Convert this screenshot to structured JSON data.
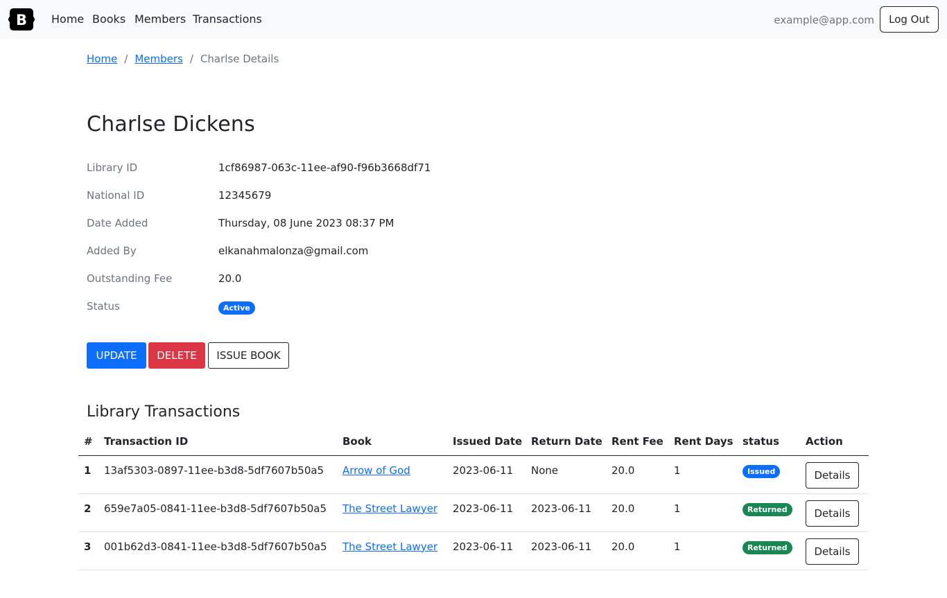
{
  "nav": {
    "brand_letter": "B",
    "links": [
      "Home",
      "Books",
      "Members",
      "Transactions"
    ],
    "user_email": "example@app.com",
    "logout_label": "Log Out"
  },
  "breadcrumb": {
    "home": "Home",
    "members": "Members",
    "current": "Charlse Details",
    "separator": "/"
  },
  "member": {
    "name": "Charlse Dickens",
    "details": [
      {
        "label": "Library ID",
        "value": "1cf86987-063c-11ee-af90-f96b3668df71"
      },
      {
        "label": "National ID",
        "value": "12345679"
      },
      {
        "label": "Date Added",
        "value": "Thursday, 08 June 2023 08:37 PM"
      },
      {
        "label": "Added By",
        "value": "elkanahmalonza@gmail.com"
      },
      {
        "label": "Outstanding Fee",
        "value": "20.0"
      },
      {
        "label": "Status",
        "value": "Active"
      }
    ]
  },
  "actions": {
    "update": "UPDATE",
    "delete": "DELETE",
    "issue": "ISSUE BOOK"
  },
  "transactions": {
    "title": "Library Transactions",
    "headers": [
      "#",
      "Transaction ID",
      "Book",
      "Issued Date",
      "Return Date",
      "Rent Fee",
      "Rent Days",
      "status",
      "Action"
    ],
    "rows": [
      {
        "num": "1",
        "id": "13af5303-0897-11ee-b3d8-5df7607b50a5",
        "book": "Arrow of God",
        "issued": "2023-06-11",
        "returned": "None",
        "fee": "20.0",
        "days": "1",
        "status": "Issued",
        "action": "Details"
      },
      {
        "num": "2",
        "id": "659e7a05-0841-11ee-b3d8-5df7607b50a5",
        "book": "The Street Lawyer",
        "issued": "2023-06-11",
        "returned": "2023-06-11",
        "fee": "20.0",
        "days": "1",
        "status": "Returned",
        "action": "Details"
      },
      {
        "num": "3",
        "id": "001b62d3-0841-11ee-b3d8-5df7607b50a5",
        "book": "The Street Lawyer",
        "issued": "2023-06-11",
        "returned": "2023-06-11",
        "fee": "20.0",
        "days": "1",
        "status": "Returned",
        "action": "Details"
      }
    ]
  },
  "colors": {
    "primary": "#0d6efd",
    "danger": "#dc3545",
    "success": "#198754",
    "muted": "#6c757d",
    "navbar_bg": "#f8f9fa"
  }
}
